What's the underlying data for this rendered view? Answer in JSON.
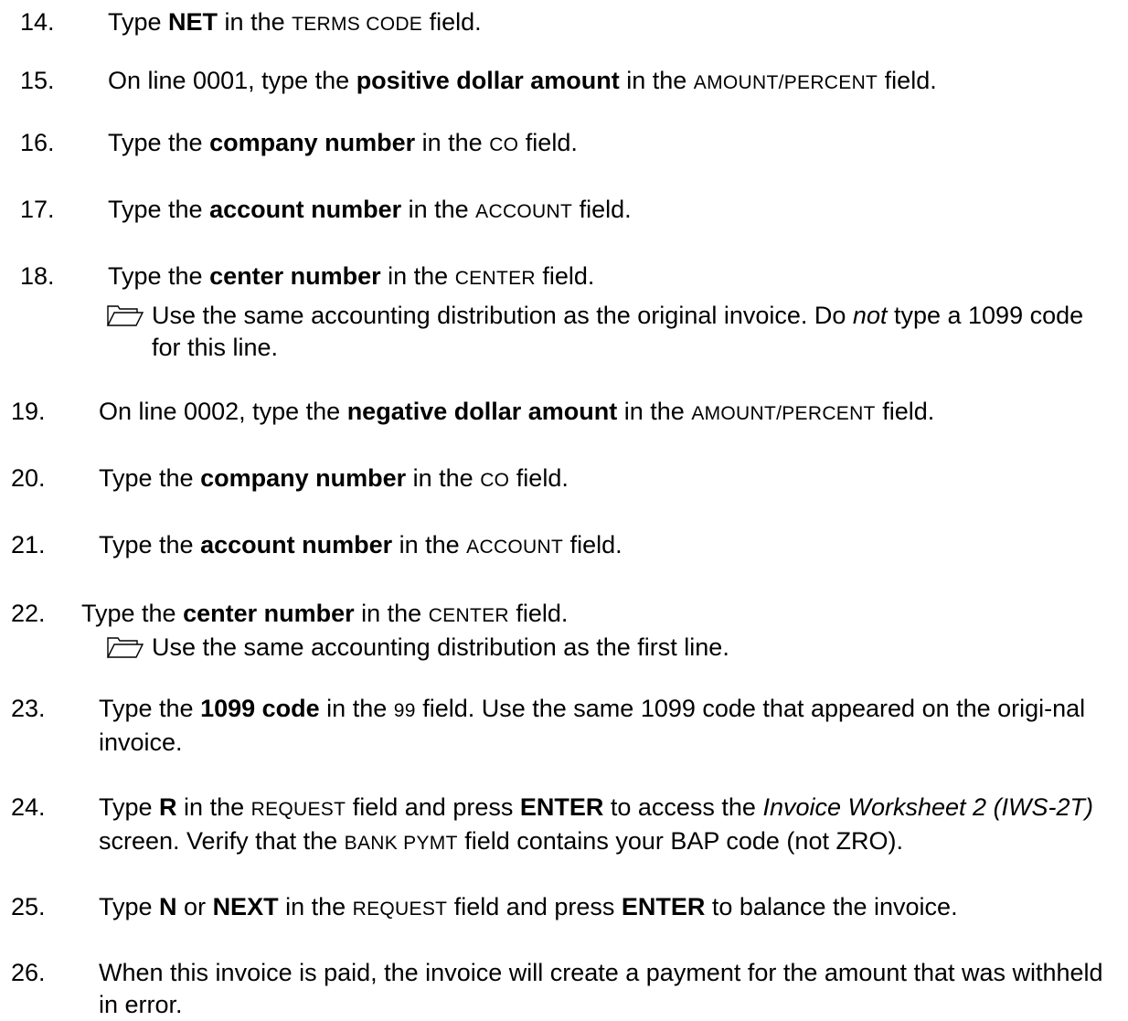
{
  "steps": [
    {
      "number": "14.",
      "parts": [
        "Type ",
        "NET",
        " in the ",
        "TERMS CODE",
        " field."
      ]
    },
    {
      "number": "15.",
      "parts": [
        "On line 0001, type the ",
        "positive dollar amount",
        " in the ",
        "AMOUNT/PERCENT",
        " field."
      ]
    },
    {
      "number": "16.",
      "parts": [
        "Type the ",
        "company number",
        " in the ",
        "CO",
        " field."
      ]
    },
    {
      "number": "17.",
      "parts": [
        "Type the ",
        "account number",
        " in the ",
        "ACCOUNT",
        " field."
      ]
    },
    {
      "number": "18.",
      "parts": [
        "Type the ",
        "center number",
        " in the ",
        "CENTER",
        " field."
      ],
      "note": [
        "Use the same accounting distribution as the original invoice. Do ",
        "not",
        " type a 1099 code for this line."
      ]
    },
    {
      "number": "19.",
      "parts": [
        "On line 0002, type the ",
        "negative dollar amount",
        " in the ",
        "AMOUNT/PERCENT",
        " field."
      ]
    },
    {
      "number": "20.",
      "parts": [
        "Type the ",
        "company number",
        " in the ",
        "CO",
        " field."
      ]
    },
    {
      "number": "21.",
      "parts": [
        "Type the ",
        "account number",
        " in the ",
        "ACCOUNT",
        " field."
      ]
    },
    {
      "number": "22.",
      "parts": [
        "Type the ",
        "center number",
        " in the ",
        "CENTER",
        " field."
      ],
      "note": "Use the same accounting distribution as the first line."
    },
    {
      "number": "23.",
      "parts": [
        "Type the ",
        "1099 code",
        " in the ",
        "99",
        " field. Use the same 1099 code that appeared on the origi-nal invoice."
      ]
    },
    {
      "number": "24.",
      "parts": [
        "Type ",
        "R",
        " in the ",
        "REQUEST",
        " field and press ",
        "ENTER",
        " to access the ",
        "Invoice Worksheet 2 (IWS-2T)",
        " screen. Verify that the ",
        "BANK PYMT",
        " field contains your BAP code (not ZRO)."
      ]
    },
    {
      "number": "25.",
      "parts": [
        "Type ",
        "N",
        " or ",
        "NEXT",
        " in the ",
        "REQUEST",
        " field and press ",
        "ENTER",
        " to balance the invoice."
      ]
    },
    {
      "number": "26.",
      "parts": [
        "When this invoice is paid, the invoice will create a payment for the amount that was withheld in error."
      ]
    }
  ]
}
